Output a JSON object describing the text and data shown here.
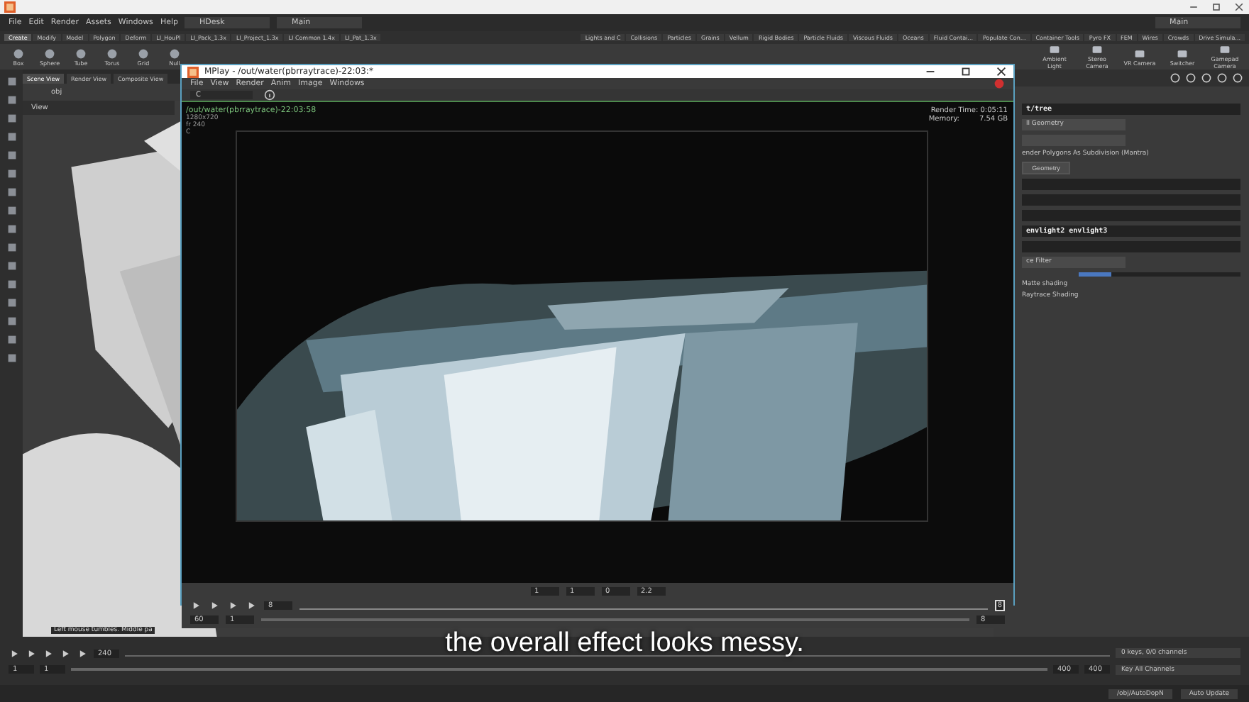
{
  "houdini": {
    "menu": [
      "File",
      "Edit",
      "Render",
      "Assets",
      "Windows",
      "Help"
    ],
    "desktop": "HDesk",
    "shelf_set": "Main",
    "shelf_set_right": "Main",
    "shelf_tabs_left": [
      {
        "label": "Create",
        "selected": true
      },
      {
        "label": "Modify",
        "selected": false
      },
      {
        "label": "Model",
        "selected": false
      },
      {
        "label": "Polygon",
        "selected": false
      },
      {
        "label": "Deform",
        "selected": false
      },
      {
        "label": "LI_HouPl",
        "selected": false
      },
      {
        "label": "LI_Pack_1.3x",
        "selected": false
      },
      {
        "label": "LI_Project_1.3x",
        "selected": false
      },
      {
        "label": "LI Common 1.4x",
        "selected": false
      },
      {
        "label": "LI_Pat_1.3x",
        "selected": false
      }
    ],
    "shelf_tabs_right": [
      "Lights and C",
      "Collisions",
      "Particles",
      "Grains",
      "Vellum",
      "Rigid Bodies",
      "Particle Fluids",
      "Viscous Fluids",
      "Oceans",
      "Fluid Contai...",
      "Populate Con...",
      "Container Tools",
      "Pyro FX",
      "FEM",
      "Wires",
      "Crowds",
      "Drive Simula..."
    ],
    "tools_left": [
      "Box",
      "Sphere",
      "Tube",
      "Torus",
      "Grid",
      "Null"
    ],
    "tools_right": [
      "Ambient Light",
      "Stereo Camera",
      "VR Camera",
      "Switcher",
      "Gamepad Camera"
    ],
    "pane_tabs": [
      {
        "label": "Scene View",
        "selected": true
      },
      {
        "label": "Render View",
        "selected": false
      },
      {
        "label": "Composite View",
        "selected": false
      }
    ],
    "path": "obj",
    "view_label": "View",
    "hint": "Left mouse tumbles. Middle pa",
    "params": [
      {
        "kind": "field",
        "value": "t/tree"
      },
      {
        "kind": "dropdown",
        "value": "ll Geometry"
      },
      {
        "kind": "dropdown"
      },
      {
        "kind": "label",
        "text": "ender Polygons As Subdivision (Mantra)"
      },
      {
        "kind": "button",
        "text": "Geometry"
      },
      {
        "kind": "field"
      },
      {
        "kind": "field"
      },
      {
        "kind": "field"
      },
      {
        "kind": "field",
        "value": "envlight2 envlight3"
      },
      {
        "kind": "field"
      },
      {
        "kind": "dropdown",
        "value": "ce Filter"
      },
      {
        "kind": "slider",
        "level": 0.2
      },
      {
        "kind": "label",
        "text": "Matte shading"
      },
      {
        "kind": "label",
        "text": "Raytrace Shading"
      }
    ],
    "timeline": {
      "frame": "240",
      "start": "1",
      "start2": "1",
      "end": "400",
      "end2": "400",
      "keys": "0 keys, 0/0 channels",
      "key_all": "Key All Channels",
      "auto_update": "Auto Update",
      "dop": "/obj/AutoDopN"
    }
  },
  "mplay": {
    "title": "MPlay - /out/water(pbrraytrace)-22:03:*",
    "menu": [
      "File",
      "View",
      "Render",
      "Anim",
      "Image",
      "Windows"
    ],
    "channel": "C",
    "info": [
      "/out/water(pbrraytrace)-22:03:58",
      "1280x720",
      "fr 240",
      "C"
    ],
    "render_time": "Render Time: 0:05:11",
    "memory_label": "Memory:",
    "memory": "7.54 GB",
    "image_controls": [
      "1",
      "1",
      "0",
      "2.2"
    ],
    "frame": "8",
    "fps": "60",
    "range_start": "1",
    "range_end": "8",
    "cursor": "8"
  },
  "subtitle": "the overall effect looks messy."
}
